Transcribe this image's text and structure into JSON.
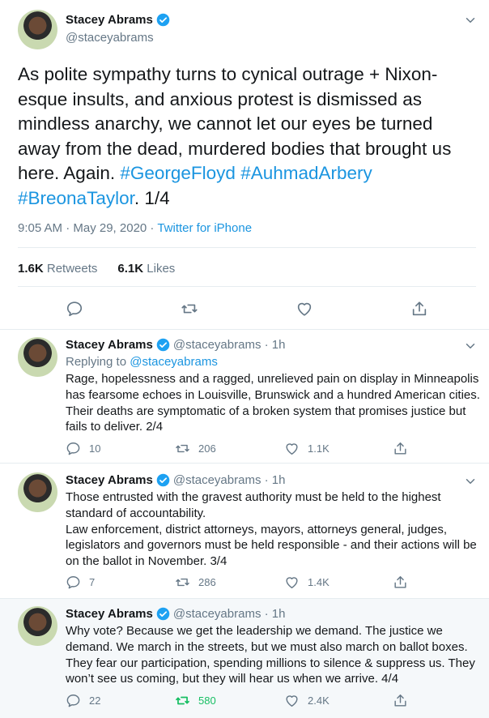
{
  "main": {
    "name": "Stacey Abrams",
    "handle": "@staceyabrams",
    "text_before": "As polite sympathy turns to cynical outrage + Nixon-esque insults, and anxious protest is dismissed as mindless anarchy, we cannot let our eyes be turned away from the dead, murdered bodies that brought us here. Again. ",
    "hashtag1": "#GeorgeFloyd",
    "hashtag2": "#AuhmadArbery",
    "hashtag3": "#BreonaTaylor",
    "text_after": ". 1/4",
    "time": "9:05 AM · May 29, 2020 · ",
    "source": "Twitter for iPhone",
    "retweets_count": "1.6K",
    "retweets_label": "Retweets",
    "likes_count": "6.1K",
    "likes_label": "Likes"
  },
  "replies": [
    {
      "name": "Stacey Abrams",
      "handle": "@staceyabrams · 1h",
      "replying_label": "Replying to ",
      "replying_handle": "@staceyabrams",
      "text": "Rage, hopelessness and a ragged, unrelieved pain on display in Minneapolis has fearsome echoes in Louisville, Brunswick and a hundred American cities. Their deaths are symptomatic of a broken system that promises justice but fails to deliver. 2/4",
      "replies": "10",
      "retweets": "206",
      "likes": "1.1K"
    },
    {
      "name": "Stacey Abrams",
      "handle": "@staceyabrams · 1h",
      "text_line1": "Those entrusted with the gravest authority must be held to the highest standard of accountability.",
      "text_line2": "Law enforcement, district attorneys, mayors, attorneys general, judges, legislators and governors must be held responsible - and their actions will be on the ballot in November. 3/4",
      "replies": "7",
      "retweets": "286",
      "likes": "1.4K"
    },
    {
      "name": "Stacey Abrams",
      "handle": "@staceyabrams · 1h",
      "text": "Why vote? Because we get the leadership we demand. The justice we demand. We march in the streets, but we must also march on ballot boxes. They fear our participation, spending millions to silence & suppress us. They won’t see us coming, but they will hear us when we arrive. 4/4",
      "replies": "22",
      "retweets": "580",
      "likes": "2.4K"
    }
  ],
  "colors": {
    "accent": "#1b95e0",
    "muted": "#657786",
    "retweeted": "#17bf63"
  }
}
